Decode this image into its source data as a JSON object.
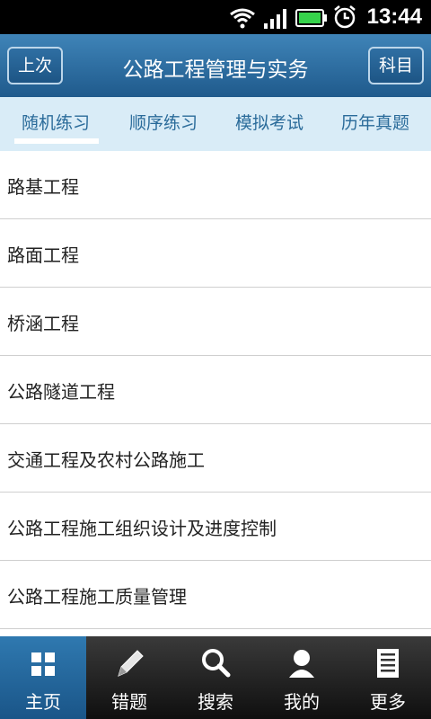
{
  "status": {
    "time": "13:44"
  },
  "header": {
    "title": "公路工程管理与实务",
    "left_button": "上次",
    "right_button": "科目"
  },
  "tabs": [
    {
      "label": "随机练习",
      "active": true
    },
    {
      "label": "顺序练习",
      "active": false
    },
    {
      "label": "模拟考试",
      "active": false
    },
    {
      "label": "历年真题",
      "active": false
    }
  ],
  "list": [
    "路基工程",
    "路面工程",
    "桥涵工程",
    "公路隧道工程",
    "交通工程及农村公路施工",
    "公路工程施工组织设计及进度控制",
    "公路工程施工质量管理"
  ],
  "bottom_nav": [
    {
      "label": "主页",
      "icon": "grid-icon",
      "active": true
    },
    {
      "label": "错题",
      "icon": "pencil-icon",
      "active": false
    },
    {
      "label": "搜索",
      "icon": "search-icon",
      "active": false
    },
    {
      "label": "我的",
      "icon": "person-icon",
      "active": false
    },
    {
      "label": "更多",
      "icon": "list-icon",
      "active": false
    }
  ]
}
